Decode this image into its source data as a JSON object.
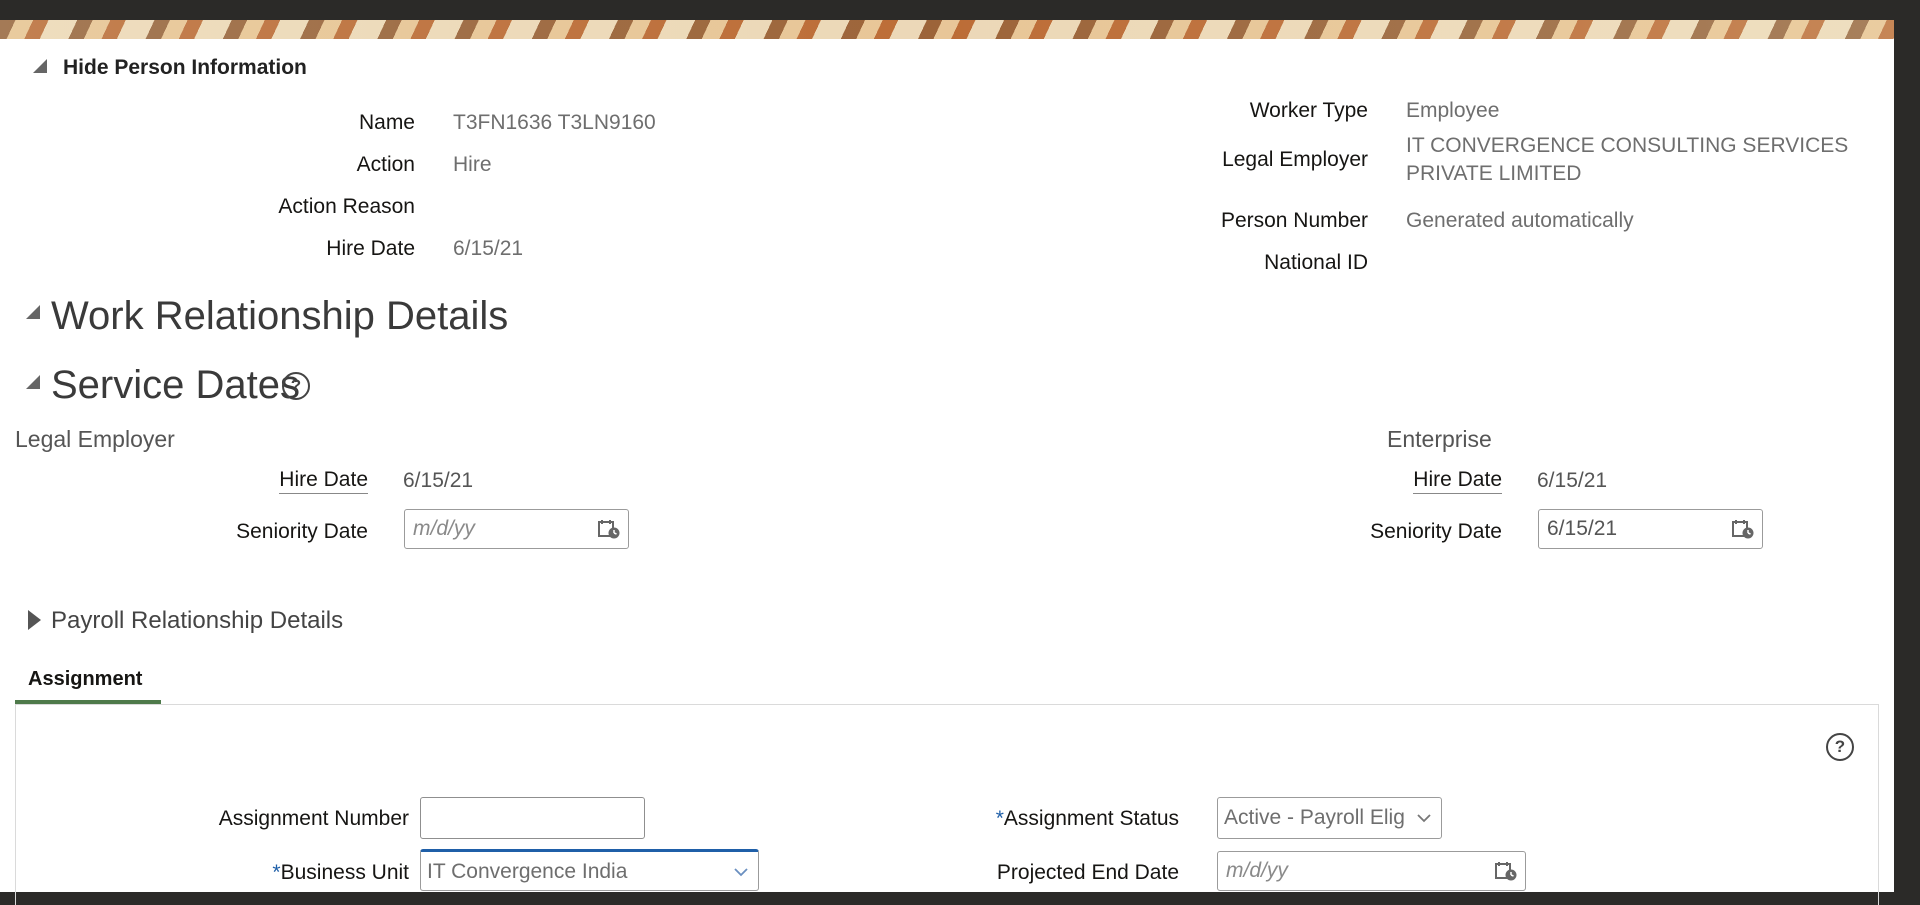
{
  "person_info": {
    "toggle_label": "Hide Person Information",
    "name_label": "Name",
    "name_value": "T3FN1636 T3LN9160",
    "action_label": "Action",
    "action_value": "Hire",
    "action_reason_label": "Action Reason",
    "action_reason_value": "",
    "hire_date_label": "Hire Date",
    "hire_date_value": "6/15/21",
    "worker_type_label": "Worker Type",
    "worker_type_value": "Employee",
    "legal_employer_label": "Legal Employer",
    "legal_employer_value_line1": "IT CONVERGENCE CONSULTING SERVICES",
    "legal_employer_value_line2": "PRIVATE LIMITED",
    "person_number_label": "Person Number",
    "person_number_value": "Generated automatically",
    "national_id_label": "National ID",
    "national_id_value": ""
  },
  "work_relationship": {
    "title": "Work Relationship Details"
  },
  "service_dates": {
    "title": "Service Dates",
    "help_icon": "?",
    "legal_employer": {
      "heading": "Legal Employer",
      "hire_date_label": "Hire Date",
      "hire_date_value": "6/15/21",
      "seniority_label": "Seniority Date",
      "seniority_placeholder": "m/d/yy",
      "seniority_value": ""
    },
    "enterprise": {
      "heading": "Enterprise",
      "hire_date_label": "Hire Date",
      "hire_date_value": "6/15/21",
      "seniority_label": "Seniority Date",
      "seniority_value": "6/15/21"
    }
  },
  "payroll_relationship": {
    "title": "Payroll Relationship Details"
  },
  "assignment": {
    "tab_label": "Assignment",
    "help_icon": "?",
    "assignment_number_label": "Assignment Number",
    "assignment_number_value": "",
    "business_unit_required": "*",
    "business_unit_label": "Business Unit",
    "business_unit_value": "IT Convergence India",
    "assignment_status_required": "*",
    "assignment_status_label": "Assignment Status",
    "assignment_status_value": "Active - Payroll Elig",
    "projected_end_label": "Projected End Date",
    "projected_end_placeholder": "m/d/yy"
  },
  "icons": [
    "collapse-triangle-icon",
    "expand-triangle-icon",
    "help-icon",
    "calendar-icon",
    "chevron-down-icon"
  ],
  "colors": {
    "tab_accent": "#4e7a4a",
    "required_marker": "#1f5fa8",
    "focused_border": "#1f5fa8"
  }
}
